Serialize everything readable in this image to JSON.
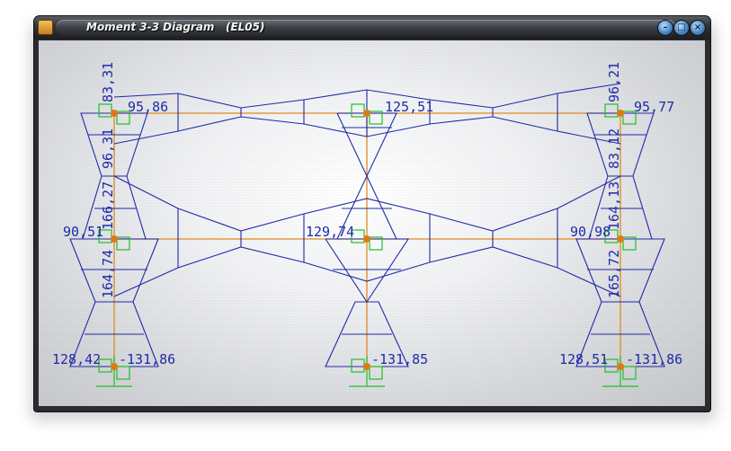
{
  "window": {
    "title": "Moment 3-3 Diagram   (EL05)",
    "app_icon": "etabs-icon",
    "buttons": [
      "minimize-icon",
      "maximize-icon",
      "close-icon"
    ]
  },
  "colors": {
    "frame": "#e08a1e",
    "joint": "#e07a10",
    "diagram": "#1f2aa8",
    "support": "#1fbf2a"
  },
  "diagram": {
    "labels": {
      "c1_top_vert": "83,31",
      "c1_top_mid": "96,31",
      "c1_top_right": "95,86",
      "c3_top_vert": "96,21",
      "c3_top_mid": "83,12",
      "c3_top_right": "95,77",
      "c2_top": "125,51",
      "c1_mid_left": "90,51",
      "c1_mid_vert_top": "166,27",
      "c1_mid_vert_bot": "164,74",
      "c2_mid": "129,74",
      "c3_mid_left": "90,98",
      "c3_mid_vert_top": "164,13",
      "c3_mid_vert_bot": "165,72",
      "c1_base_left": "128,42",
      "c1_base_right": "-131,86",
      "c2_base_right": "-131,85",
      "c3_base_left": "128,51",
      "c3_base_right": "-131,86"
    }
  }
}
